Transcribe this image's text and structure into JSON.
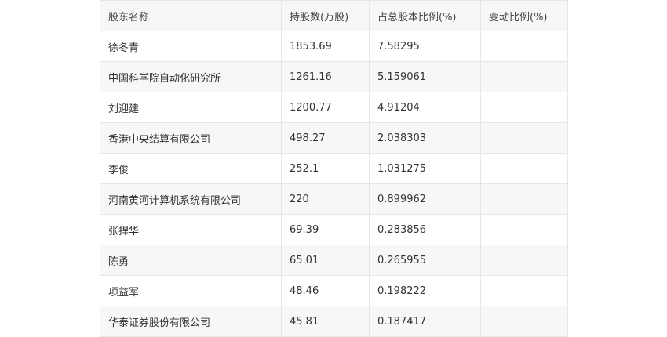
{
  "table": {
    "headers": [
      "股东名称",
      "持股数(万股)",
      "占总股本比例(%)",
      "变动比例(%)"
    ],
    "rows": [
      [
        "徐冬青",
        "1853.69",
        "7.58295",
        ""
      ],
      [
        "中国科学院自动化研究所",
        "1261.16",
        "5.159061",
        ""
      ],
      [
        "刘迎建",
        "1200.77",
        "4.91204",
        ""
      ],
      [
        "香港中央结算有限公司",
        "498.27",
        "2.038303",
        ""
      ],
      [
        "李俊",
        "252.1",
        "1.031275",
        ""
      ],
      [
        "河南黄河计算机系统有限公司",
        "220",
        "0.899962",
        ""
      ],
      [
        "张捍华",
        "69.39",
        "0.283856",
        ""
      ],
      [
        "陈勇",
        "65.01",
        "0.265955",
        ""
      ],
      [
        "项益军",
        "48.46",
        "0.198222",
        ""
      ],
      [
        "华泰证券股份有限公司",
        "45.81",
        "0.187417",
        ""
      ]
    ]
  }
}
